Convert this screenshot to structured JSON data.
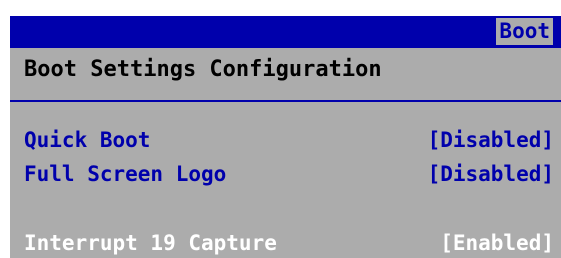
{
  "header": {
    "active_tab": "Boot"
  },
  "section": {
    "title": "Boot Settings Configuration"
  },
  "settings": [
    {
      "label": "Quick Boot",
      "value": "[Disabled]"
    },
    {
      "label": "Full Screen Logo",
      "value": "[Disabled]"
    },
    {
      "label": "Interrupt 19 Capture",
      "value": "[Enabled]"
    }
  ],
  "colors": {
    "bar_blue": "#0000ac",
    "panel_gray": "#acacac",
    "text_white": "#ffffff",
    "text_black": "#000000"
  }
}
